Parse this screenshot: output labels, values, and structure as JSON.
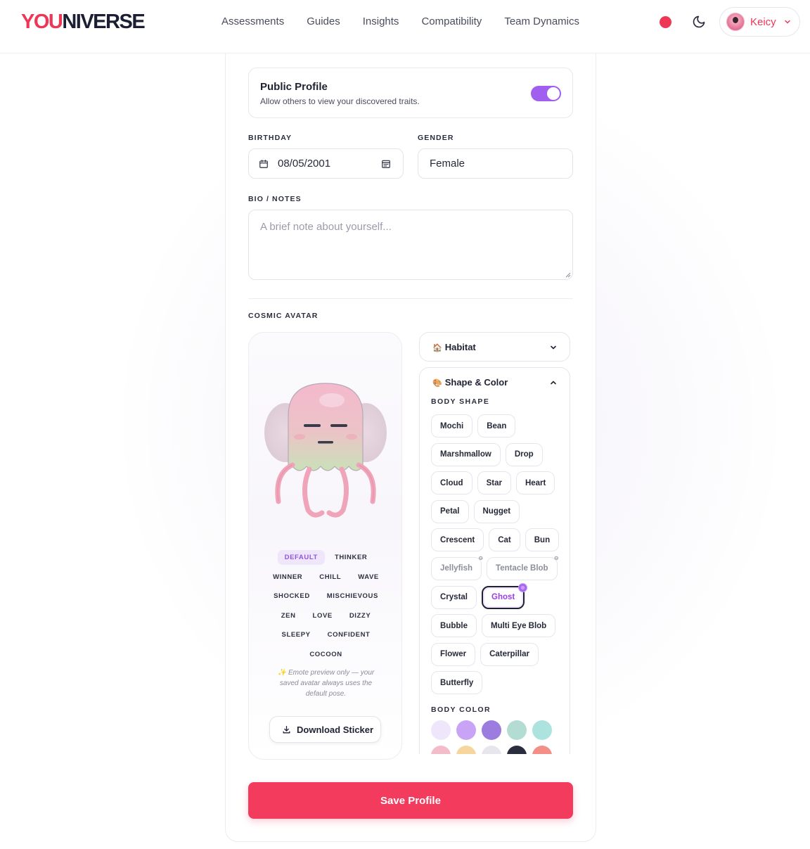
{
  "header": {
    "logo_part1": "YOU",
    "logo_part2": "NIVERSE",
    "nav": [
      "Assessments",
      "Guides",
      "Insights",
      "Compatibility",
      "Team Dynamics"
    ],
    "user_name": "Keicy",
    "accent_color": "#ee3756"
  },
  "profile": {
    "public_title": "Public Profile",
    "public_desc": "Allow others to view your discovered traits.",
    "public_enabled": true,
    "birthday_label": "BIRTHDAY",
    "birthday_value": "08/05/2001",
    "gender_label": "GENDER",
    "gender_value": "Female",
    "bio_label": "BIO / NOTES",
    "bio_placeholder": "A brief note about yourself...",
    "avatar_label": "COSMIC AVATAR"
  },
  "emotes": {
    "rows": [
      [
        "DEFAULT",
        "THINKER"
      ],
      [
        "WINNER",
        "CHILL",
        "WAVE"
      ],
      [
        "SHOCKED",
        "MISCHIEVOUS"
      ],
      [
        "ZEN",
        "LOVE",
        "DIZZY"
      ],
      [
        "SLEEPY",
        "CONFIDENT"
      ],
      [
        "COCOON"
      ]
    ],
    "active": "DEFAULT",
    "note": "✨ Emote preview only — your saved avatar always uses the default pose.",
    "download_label": "Download Sticker"
  },
  "accordions": {
    "habitat_icon": "🏠",
    "habitat_label": "Habitat",
    "shape_icon": "🎨",
    "shape_label": "Shape & Color",
    "body_shape_label": "BODY SHAPE",
    "body_color_label": "BODY COLOR",
    "shape_rows": [
      [
        {
          "name": "Mochi"
        },
        {
          "name": "Bean"
        }
      ],
      [
        {
          "name": "Marshmallow"
        },
        {
          "name": "Drop"
        }
      ],
      [
        {
          "name": "Cloud"
        },
        {
          "name": "Star"
        },
        {
          "name": "Heart"
        }
      ],
      [
        {
          "name": "Petal"
        },
        {
          "name": "Nugget"
        }
      ],
      [
        {
          "name": "Crescent"
        },
        {
          "name": "Cat"
        },
        {
          "name": "Bun"
        }
      ],
      [
        {
          "name": "Jellyfish",
          "locked": true
        },
        {
          "name": "Tentacle Blob",
          "locked": true
        }
      ],
      [
        {
          "name": "Crystal"
        },
        {
          "name": "Ghost",
          "selected": true
        }
      ],
      [
        {
          "name": "Bubble"
        },
        {
          "name": "Multi Eye Blob"
        }
      ],
      [
        {
          "name": "Flower"
        },
        {
          "name": "Caterpillar"
        }
      ],
      [
        {
          "name": "Butterfly"
        }
      ]
    ],
    "color_rows": [
      [
        "#efe6fb",
        "#c9a4f6",
        "#9d7ce0",
        "#b3ddd3",
        "#ade3de"
      ],
      [
        "#f2bccb",
        "#f7d59e",
        "#e6e6ec",
        "#2a2d3d",
        "#f38f86"
      ]
    ]
  },
  "save_label": "Save Profile"
}
